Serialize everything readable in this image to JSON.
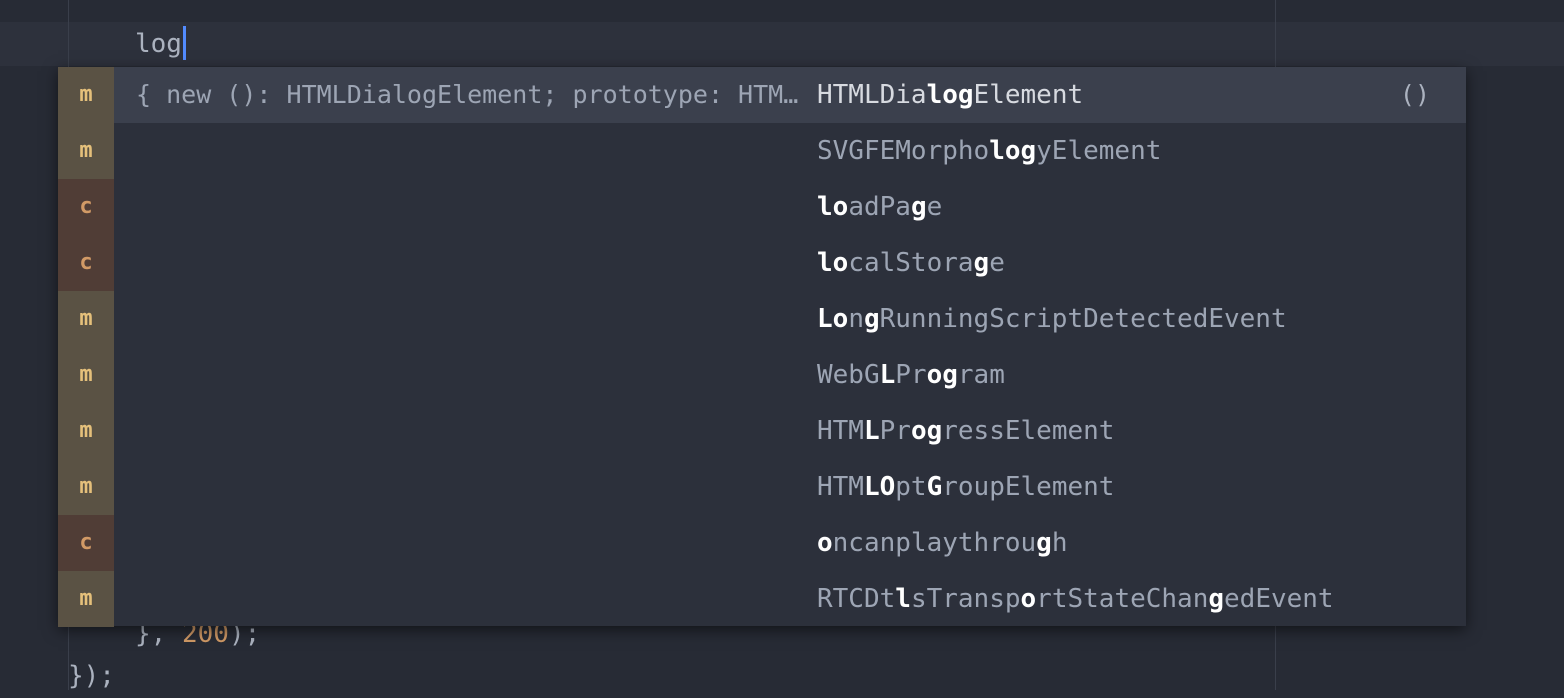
{
  "editor": {
    "typed_text": "log",
    "line_a": {
      "prefix": "}, ",
      "number": "200",
      "suffix": ");"
    },
    "line_b": "});"
  },
  "autocomplete": {
    "selected_index": 0,
    "left_label": "{ new (): HTMLDialogElement; prototype: HTM…",
    "right_label": "()",
    "items": [
      {
        "type": "m",
        "kind": "method",
        "name": "HTMLDialogElement",
        "segments": [
          [
            "HTMLDia",
            0
          ],
          [
            "log",
            1
          ],
          [
            "Element",
            0
          ]
        ]
      },
      {
        "type": "m",
        "kind": "method",
        "name": "SVGFEMorphologyElement",
        "segments": [
          [
            "SVGFEMorpho",
            0
          ],
          [
            "log",
            1
          ],
          [
            "yElement",
            0
          ]
        ]
      },
      {
        "type": "c",
        "kind": "constant",
        "name": "loadPage",
        "segments": [
          [
            "lo",
            1
          ],
          [
            "adPa",
            0
          ],
          [
            "g",
            1
          ],
          [
            "e",
            0
          ]
        ]
      },
      {
        "type": "c",
        "kind": "constant",
        "name": "localStorage",
        "segments": [
          [
            "lo",
            1
          ],
          [
            "calStora",
            0
          ],
          [
            "g",
            1
          ],
          [
            "e",
            0
          ]
        ]
      },
      {
        "type": "m",
        "kind": "method",
        "name": "LongRunningScriptDetectedEvent",
        "segments": [
          [
            "Lo",
            1
          ],
          [
            "n",
            0
          ],
          [
            "g",
            1
          ],
          [
            "RunningScriptDetectedEvent",
            0
          ]
        ]
      },
      {
        "type": "m",
        "kind": "method",
        "name": "WebGLProgram",
        "segments": [
          [
            "WebG",
            0
          ],
          [
            "L",
            1
          ],
          [
            "Pr",
            0
          ],
          [
            "og",
            1
          ],
          [
            "ram",
            0
          ]
        ]
      },
      {
        "type": "m",
        "kind": "method",
        "name": "HTMLProgressElement",
        "segments": [
          [
            "HTM",
            0
          ],
          [
            "L",
            1
          ],
          [
            "Pr",
            0
          ],
          [
            "og",
            1
          ],
          [
            "ressElement",
            0
          ]
        ]
      },
      {
        "type": "m",
        "kind": "method",
        "name": "HTMLOptGroupElement",
        "segments": [
          [
            "HTM",
            0
          ],
          [
            "LO",
            1
          ],
          [
            "pt",
            0
          ],
          [
            "G",
            1
          ],
          [
            "roupElement",
            0
          ]
        ]
      },
      {
        "type": "c",
        "kind": "constant",
        "name": "oncanplaythrough",
        "segments": [
          [
            "o",
            1
          ],
          [
            "ncanplaythrou",
            0
          ],
          [
            "g",
            1
          ],
          [
            "h",
            0
          ]
        ]
      },
      {
        "type": "m",
        "kind": "method",
        "name": "RTCDtlsTransportStateChangedEvent",
        "segments": [
          [
            "RTCDt",
            0
          ],
          [
            "l",
            1
          ],
          [
            "sTransp",
            0
          ],
          [
            "o",
            1
          ],
          [
            "rtStateChan",
            0
          ],
          [
            "g",
            1
          ],
          [
            "edEvent",
            0
          ]
        ]
      }
    ]
  },
  "colors": {
    "background": "#272b35",
    "popup": "#2c303b",
    "selected_row": "#3b404d",
    "method_badge": "#e5c07b",
    "constant_badge": "#d19a66",
    "cursor": "#528bff",
    "number": "#d19a66"
  }
}
